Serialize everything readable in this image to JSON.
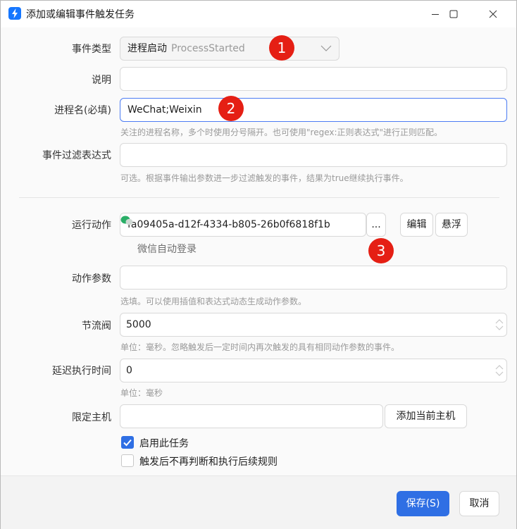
{
  "window": {
    "title": "添加或编辑事件触发任务",
    "minimize_icon": "minimize-icon",
    "maximize_icon": "maximize-icon",
    "close_icon": "close-icon",
    "accent": "#2f6fe4"
  },
  "form": {
    "event_type": {
      "label": "事件类型",
      "value": "进程启动",
      "value_sub": "ProcessStarted"
    },
    "description": {
      "label": "说明",
      "value": ""
    },
    "process_name": {
      "label": "进程名(必填)",
      "value": "WeChat;Weixin",
      "hint": "关注的进程名称，多个时使用分号隔开。也可使用\"regex:正则表达式\"进行正则匹配。"
    },
    "event_filter": {
      "label": "事件过滤表达式",
      "value": "",
      "hint": "可选。根据事件输出参数进一步过滤触发的事件，结果为true继续执行事件。"
    },
    "run_action": {
      "label": "运行动作",
      "value": "fa09405a-d12f-4334-b805-26b0f6818f1b",
      "browse_label": "...",
      "edit_label": "编辑",
      "float_label": "悬浮",
      "action_name": "微信自动登录"
    },
    "action_params": {
      "label": "动作参数",
      "value": "",
      "hint": "选填。可以使用插值和表达式动态生成动作参数。"
    },
    "throttle": {
      "label": "节流阀",
      "value": "5000",
      "hint": "单位：毫秒。忽略触发后一定时间内再次触发的具有相同动作参数的事件。"
    },
    "delay": {
      "label": "延迟执行时间",
      "value": "0",
      "hint": "单位：毫秒"
    },
    "host": {
      "label": "限定主机",
      "value": "",
      "add_label": "添加当前主机"
    },
    "enable_task": {
      "label": "启用此任务",
      "checked": true
    },
    "stop_after": {
      "label": "触发后不再判断和执行后续规则",
      "checked": false
    }
  },
  "badges": [
    "1",
    "2",
    "3"
  ],
  "footer": {
    "save_label": "保存(S)",
    "cancel_label": "取消"
  }
}
